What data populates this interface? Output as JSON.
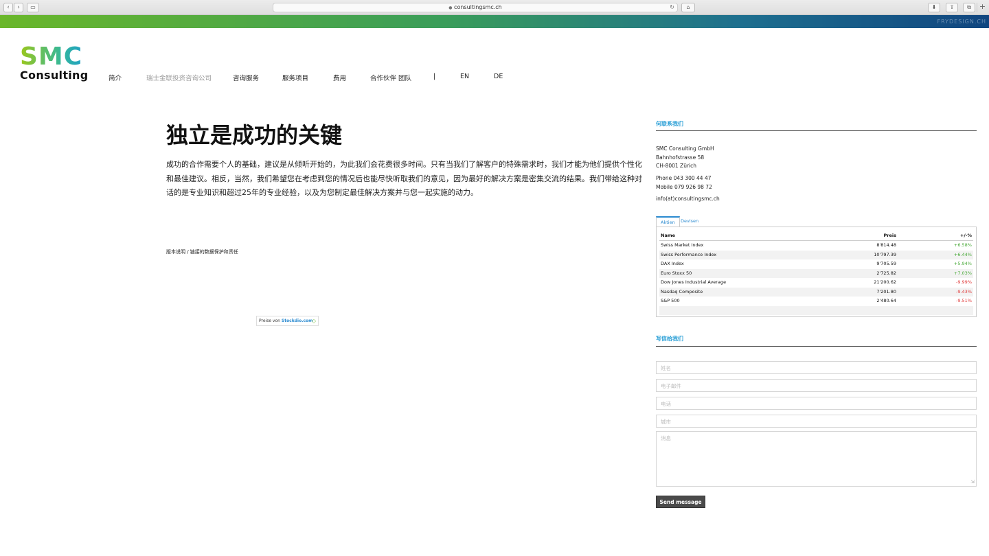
{
  "browser": {
    "url": "consultingsmc.ch",
    "lock_icon": "lock-icon",
    "reload_icon": "reload-icon",
    "back_glyph": "‹",
    "forward_glyph": "›",
    "sidebar_glyph": "▭",
    "home_glyph": "⌂",
    "download_glyph": "⬇",
    "share_glyph": "⇪",
    "tabs_glyph": "⧉",
    "newtab_glyph": "+"
  },
  "band": {
    "text": "FRYDESIGN.CH"
  },
  "logo": {
    "smc": "SMC",
    "consulting": "Consulting"
  },
  "menu": {
    "items": [
      "简介",
      "瑞士金联投资咨询公司",
      "咨询服务",
      "服务项目",
      "费用",
      "合作伙伴 团队",
      "|",
      "EN",
      "DE"
    ]
  },
  "main": {
    "headline": "独立是成功的关键",
    "body": "成功的合作需要个人的基础，建议是从倾听开始的，为此我们会花费很多时间。只有当我们了解客户的特殊需求时，我们才能为他们提供个性化和最佳建议。相反，当然，我们希望您在考虑到您的情况后也能尽快听取我们的意见，因为最好的解决方案是密集交流的结果。我们带给这种对话的是专业知识和超过25年的专业经验，以及为您制定最佳解决方案并与您一起实施的动力。",
    "footer_links": "版本说明 / 链接的数据保护和责任"
  },
  "contact": {
    "title": "何联系我们",
    "company": "SMC Consulting GmbH",
    "street": "Bahnhofstrasse 58",
    "city": "CH-8001 Zürich",
    "phone": "Phone 043 300 44 47",
    "mobile": "Mobile 079 926 98 72",
    "email": "info(at)consultingsmc.ch"
  },
  "stocks": {
    "tabs": [
      "Aktien",
      "Devisen"
    ],
    "headers": {
      "name": "Name",
      "price": "Preis",
      "change": "+/-%"
    },
    "rows": [
      {
        "name": "Swiss Market Index",
        "price": "8'814.48",
        "change": "+6.58%",
        "dir": "pos"
      },
      {
        "name": "Swiss Performance Index",
        "price": "10'797.39",
        "change": "+6.44%",
        "dir": "pos"
      },
      {
        "name": "DAX Index",
        "price": "9'705.59",
        "change": "+5.94%",
        "dir": "pos"
      },
      {
        "name": "Euro Stoxx 50",
        "price": "2'725.82",
        "change": "+7.03%",
        "dir": "pos"
      },
      {
        "name": "Dow Jones Industrial Average",
        "price": "21'200.62",
        "change": "-9.99%",
        "dir": "neg"
      },
      {
        "name": "Nasdaq Composite",
        "price": "7'201.80",
        "change": "-9.43%",
        "dir": "neg"
      },
      {
        "name": "S&P 500",
        "price": "2'480.64",
        "change": "-9.51%",
        "dir": "neg"
      }
    ],
    "footer_prefix": "Preise von ",
    "footer_brand": "Stockdio.com",
    "pos_color": "#4aaa3a",
    "neg_color": "#e03b3b"
  },
  "form": {
    "title": "写信给我们",
    "name_placeholder": "姓名",
    "email_placeholder": "电子邮件",
    "phone_placeholder": "电话",
    "city_placeholder": "城市",
    "message_placeholder": "消息",
    "send_label": "Send message"
  },
  "colors": {
    "accent": "#2a9fd6",
    "button": "#4a4a4a"
  }
}
